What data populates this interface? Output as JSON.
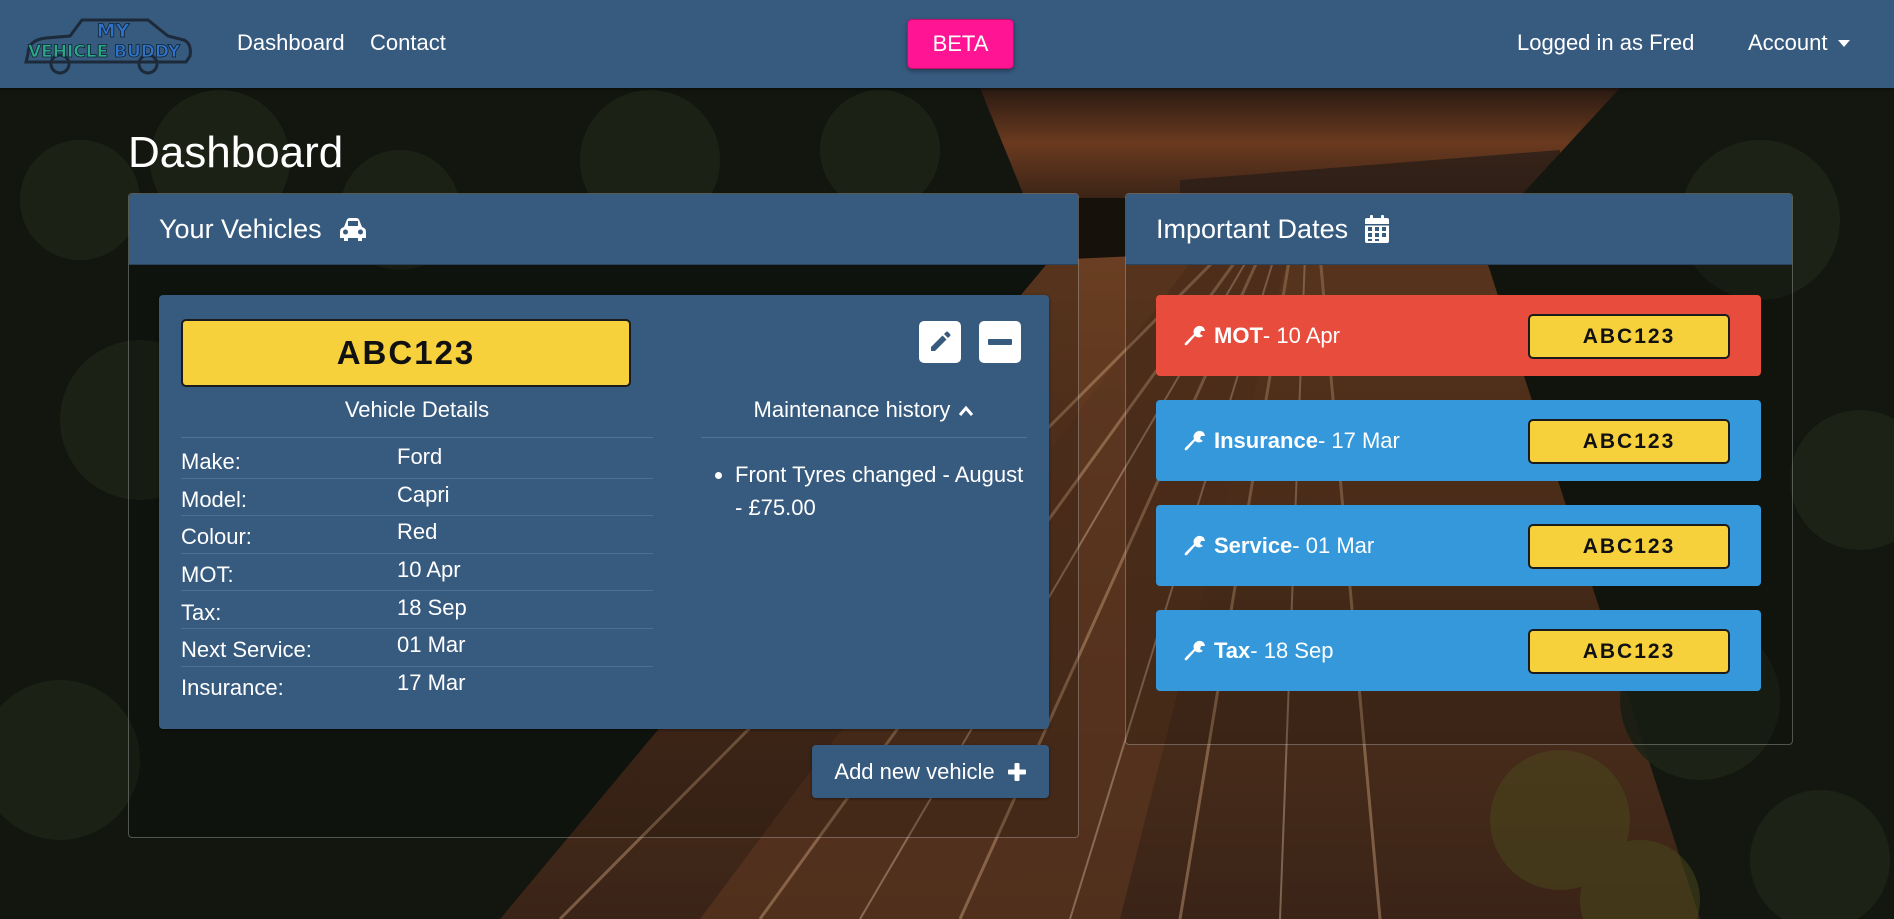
{
  "colors": {
    "navbar": "#375a7f",
    "beta": "#ff1493",
    "plate": "#f6d13b",
    "danger": "#e74c3c",
    "info": "#3498db",
    "logo_teal": "#2aa889",
    "logo_blue": "#2f73c9"
  },
  "logo": {
    "line1": "MY",
    "line2a": "VEHICLE",
    "line2b": "BUDDY"
  },
  "nav": {
    "dashboard": "Dashboard",
    "contact": "Contact",
    "beta": "BETA",
    "logged_in": "Logged in as Fred",
    "account": "Account"
  },
  "page": {
    "title": "Dashboard"
  },
  "vehicles": {
    "title": "Your Vehicles",
    "icon": "car-icon",
    "vehicle": {
      "plate": "ABC123",
      "details_title": "Vehicle Details",
      "maintenance_title": "Maintenance history",
      "details": [
        {
          "label": "Make:",
          "value": "Ford"
        },
        {
          "label": "Model:",
          "value": "Capri"
        },
        {
          "label": "Colour:",
          "value": "Red"
        },
        {
          "label": "MOT:",
          "value": "10 Apr"
        },
        {
          "label": "Tax:",
          "value": "18 Sep"
        },
        {
          "label": "Next Service:",
          "value": "01 Mar"
        },
        {
          "label": "Insurance:",
          "value": "17 Mar"
        }
      ],
      "maintenance": [
        "Front Tyres changed - August - £75.00"
      ]
    },
    "add_button": "Add new vehicle"
  },
  "dates": {
    "title": "Important Dates",
    "icon": "calendar-icon",
    "items": [
      {
        "type": "MOT",
        "date": " - 10 Apr",
        "plate": "ABC123",
        "status": "danger"
      },
      {
        "type": "Insurance",
        "date": " - 17 Mar",
        "plate": "ABC123",
        "status": "info"
      },
      {
        "type": "Service",
        "date": " - 01 Mar",
        "plate": "ABC123",
        "status": "info"
      },
      {
        "type": "Tax",
        "date": " - 18 Sep",
        "plate": "ABC123",
        "status": "info"
      }
    ]
  }
}
